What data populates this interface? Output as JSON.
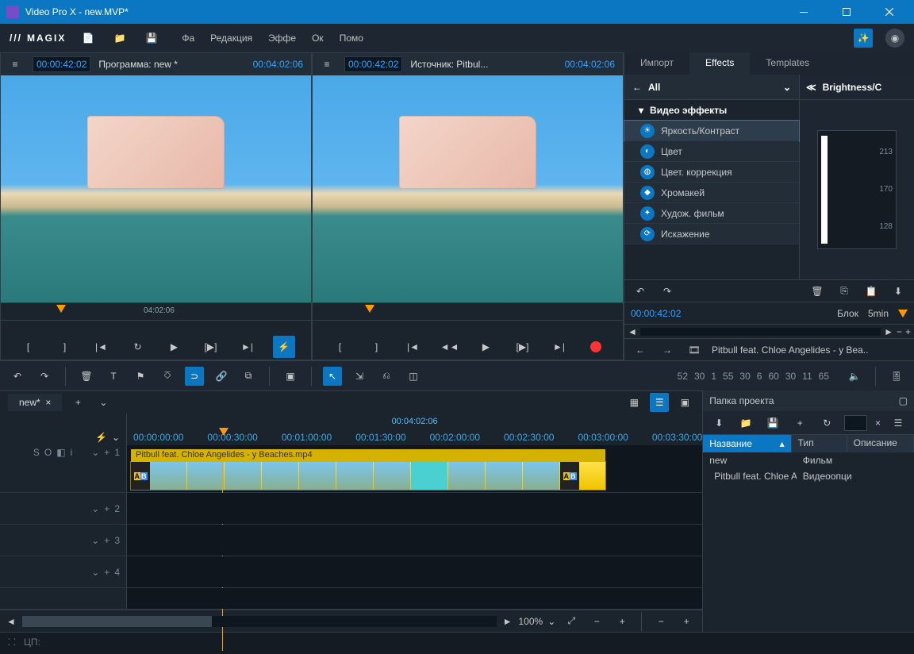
{
  "window": {
    "title": "Video Pro X - new.MVP*"
  },
  "brand": "MAGIX",
  "menus": [
    "Фа",
    "Редакция",
    "Эффе",
    "Ок",
    "Помо"
  ],
  "monitors": {
    "left": {
      "tc": "00:00:42:02",
      "label": "Программа: new *",
      "dur": "00:04:02:06",
      "scrub_label": "04:02:06"
    },
    "right": {
      "tc": "00:00:42:02",
      "label": "Источник: Pitbul...",
      "dur": "00:04:02:06"
    }
  },
  "right_tabs": [
    "Импорт",
    "Effects",
    "Templates"
  ],
  "effects": {
    "all": "All",
    "side_title": "Brightness/C",
    "category": "Видео эффекты",
    "items": [
      "Яркость/Контраст",
      "Цвет",
      "Цвет. коррекция",
      "Хромакей",
      "Худож. фильм",
      "Искажение"
    ],
    "histo_ticks": [
      "213",
      "170",
      "128"
    ],
    "kf_tc": "00:00:42:02",
    "kf_block": "Блок",
    "kf_5min": "5min",
    "path": "Pitbull feat. Chloe Angelides - y Bea.."
  },
  "edit_ruler": [
    "52",
    "30",
    "1",
    "55",
    "30",
    "6",
    "60",
    "30",
    "11",
    "65"
  ],
  "tl_tab": "new*",
  "timeline": {
    "total": "00:04:02:06",
    "ticks": [
      "00:00:00:00",
      "00:00:30:00",
      "00:01:00:00",
      "00:01:30:00",
      "00:02:00:00",
      "00:02:30:00",
      "00:03:00:00",
      "00:03:30:00"
    ],
    "clip_name": "Pitbull feat. Chloe Angelides - y Beaches.mp4",
    "zoom": "100%",
    "mode_icons": [
      "S",
      "O",
      "◧",
      "i"
    ]
  },
  "project": {
    "title": "Папка проекта",
    "cols": [
      "Название",
      "Тип",
      "Описание"
    ],
    "rows": [
      {
        "name": "new",
        "type": "Фильм"
      },
      {
        "name": "Pitbull feat. Chloe Angeli...",
        "type": "Видеоопци"
      }
    ]
  },
  "status": "ЦП:"
}
